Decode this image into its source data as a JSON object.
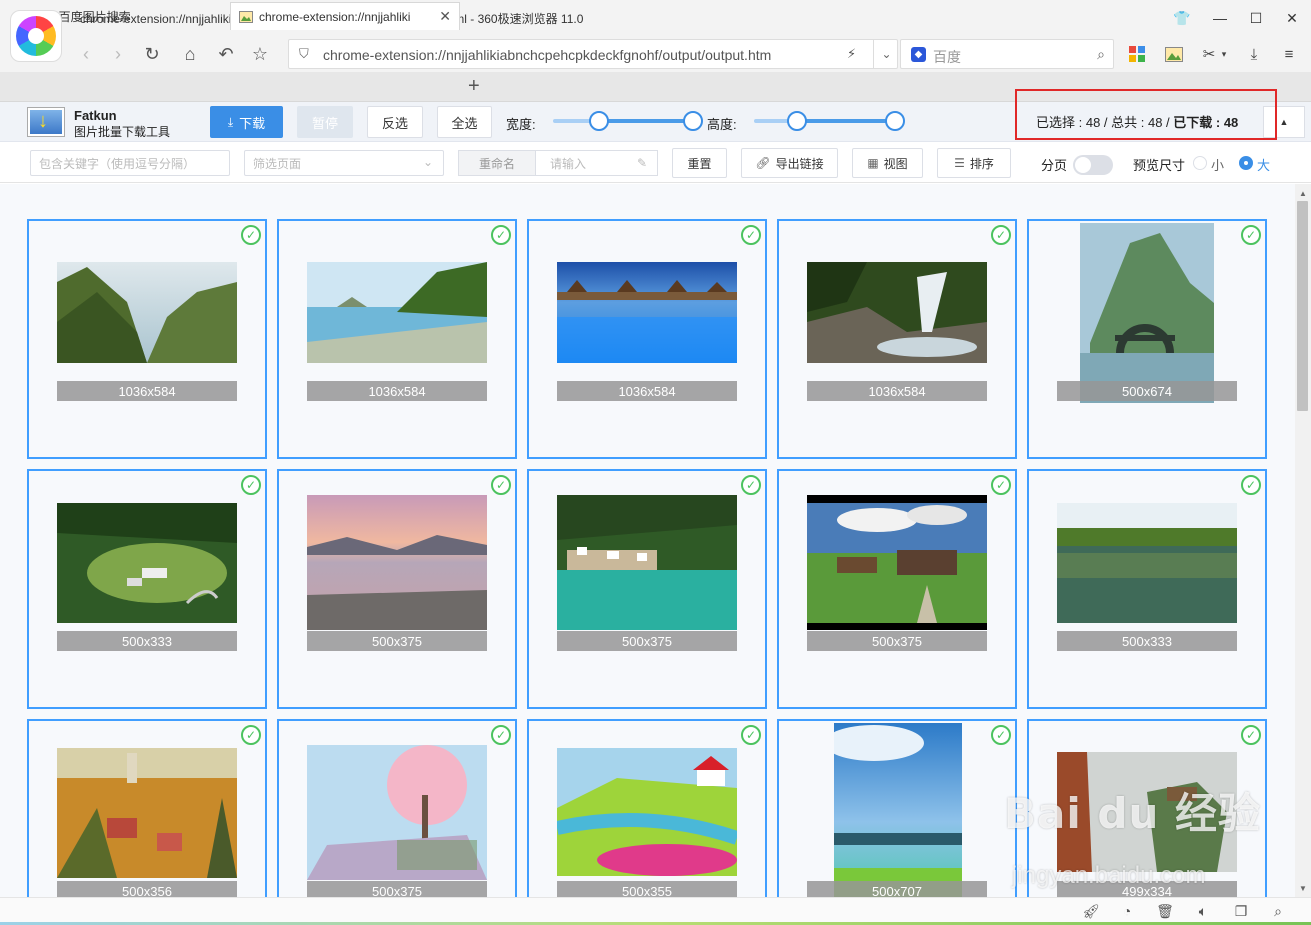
{
  "window": {
    "title": "chrome-extension://nnjjahlikiabnchcpehcpkdeckfgnohf/output/output.html - 360极速浏览器 11.0"
  },
  "nav": {
    "url": "chrome-extension://nnjjahlikiabnchcpehcpkdeckfgnohf/output/output.htm",
    "search_placeholder": "百度"
  },
  "tabs": [
    {
      "label": "风景_百度图片搜索"
    },
    {
      "label": "chrome-extension://nnjjahliki"
    }
  ],
  "toolbar": {
    "brand_name": "Fatkun",
    "brand_sub": "图片批量下载工具",
    "download": "下载",
    "pause": "暂停",
    "invert": "反选",
    "select_all": "全选",
    "width_label": "宽度:",
    "height_label": "高度:",
    "status_selected": "已选择 : 48 / 总共 : 48 / ",
    "status_downloaded": "已下载 : 48"
  },
  "filter": {
    "keyword_placeholder": "包含关键字（使用逗号分隔）",
    "page_placeholder": "筛选页面",
    "rename": "重命名",
    "rename_placeholder": "请输入",
    "reset": "重置",
    "export": "导出链接",
    "view": "视图",
    "sort": "排序",
    "paging": "分页",
    "preview_size": "预览尺寸",
    "small": "小",
    "large": "大"
  },
  "images": [
    {
      "size": "1036x584",
      "tone": "mountain"
    },
    {
      "size": "1036x584",
      "tone": "beach"
    },
    {
      "size": "1036x584",
      "tone": "resort"
    },
    {
      "size": "1036x584",
      "tone": "waterfall"
    },
    {
      "size": "500x674",
      "tone": "bridge"
    },
    {
      "size": "500x333",
      "tone": "valley"
    },
    {
      "size": "500x375",
      "tone": "sunset"
    },
    {
      "size": "500x375",
      "tone": "lake"
    },
    {
      "size": "500x375",
      "tone": "alps"
    },
    {
      "size": "500x333",
      "tone": "reflection"
    },
    {
      "size": "500x356",
      "tone": "painting"
    },
    {
      "size": "500x375",
      "tone": "anime"
    },
    {
      "size": "500x355",
      "tone": "cartoon"
    },
    {
      "size": "500x707",
      "tone": "sea"
    },
    {
      "size": "499x334",
      "tone": "cliff"
    }
  ],
  "watermark": {
    "main": "Bai du 经验",
    "sub": "jingyan.baidu.com"
  }
}
